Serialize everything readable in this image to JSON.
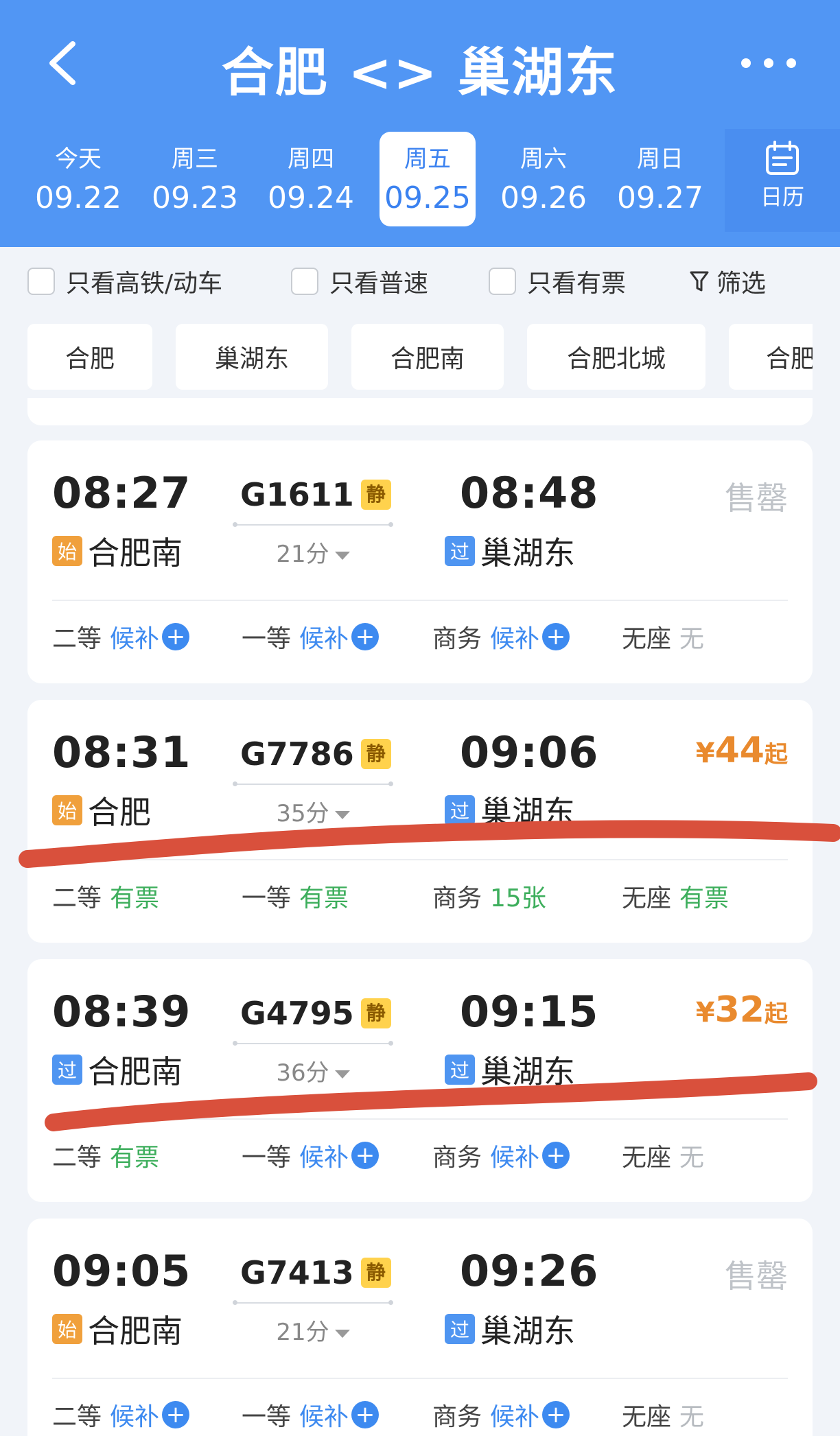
{
  "header": {
    "title": "合肥 <> 巢湖东",
    "calendar_label": "日历",
    "background": "#5196f4"
  },
  "dates": [
    {
      "weekday": "今天",
      "date": "09.22"
    },
    {
      "weekday": "周三",
      "date": "09.23"
    },
    {
      "weekday": "周四",
      "date": "09.24"
    },
    {
      "weekday": "周五",
      "date": "09.25",
      "selected": true
    },
    {
      "weekday": "周六",
      "date": "09.26"
    },
    {
      "weekday": "周日",
      "date": "09.27"
    }
  ],
  "filters": {
    "high_speed_only": "只看高铁/动车",
    "regular_only": "只看普速",
    "available_only": "只看有票",
    "filter": "筛选"
  },
  "stations": [
    "合肥",
    "巢湖东",
    "合肥南",
    "合肥北城",
    "合肥"
  ],
  "trains": [
    {
      "depart": "08:27",
      "train_no": "G1611",
      "tag": "静",
      "arrive": "08:48",
      "duration": "21分",
      "from_badge": "始",
      "from": "合肥南",
      "to_badge": "过",
      "to": "巢湖东",
      "status": "售罄",
      "seats": [
        {
          "class": "二等",
          "status": "候补",
          "plus": "+"
        },
        {
          "class": "一等",
          "status": "候补",
          "plus": "+"
        },
        {
          "class": "商务",
          "status": "候补",
          "plus": "+"
        },
        {
          "class": "无座",
          "status": "无"
        }
      ]
    },
    {
      "depart": "08:31",
      "train_no": "G7786",
      "tag": "静",
      "arrive": "09:06",
      "duration": "35分",
      "from_badge": "始",
      "from": "合肥",
      "to_badge": "过",
      "to": "巢湖东",
      "price": {
        "currency": "¥",
        "amount": "44",
        "suffix": "起"
      },
      "seats": [
        {
          "class": "二等",
          "status": "有票"
        },
        {
          "class": "一等",
          "status": "有票"
        },
        {
          "class": "商务",
          "status": "15张"
        },
        {
          "class": "无座",
          "status": "有票"
        }
      ]
    },
    {
      "depart": "08:39",
      "train_no": "G4795",
      "tag": "静",
      "arrive": "09:15",
      "duration": "36分",
      "from_badge": "过",
      "from": "合肥南",
      "to_badge": "过",
      "to": "巢湖东",
      "price": {
        "currency": "¥",
        "amount": "32",
        "suffix": "起"
      },
      "seats": [
        {
          "class": "二等",
          "status": "有票"
        },
        {
          "class": "一等",
          "status": "候补",
          "plus": "+"
        },
        {
          "class": "商务",
          "status": "候补",
          "plus": "+"
        },
        {
          "class": "无座",
          "status": "无"
        }
      ]
    },
    {
      "depart": "09:05",
      "train_no": "G7413",
      "tag": "静",
      "arrive": "09:26",
      "duration": "21分",
      "from_badge": "始",
      "from": "合肥南",
      "to_badge": "过",
      "to": "巢湖东",
      "status": "售罄",
      "seats": [
        {
          "class": "二等",
          "status": "候补",
          "plus": "+"
        },
        {
          "class": "一等",
          "status": "候补",
          "plus": "+"
        },
        {
          "class": "商务",
          "status": "候补",
          "plus": "+"
        },
        {
          "class": "无座",
          "status": "无"
        }
      ]
    }
  ],
  "colors": {
    "accent": "#3d8af0",
    "available": "#3dae5c",
    "price": "#e98a2e",
    "annotation": "#d9503c"
  }
}
